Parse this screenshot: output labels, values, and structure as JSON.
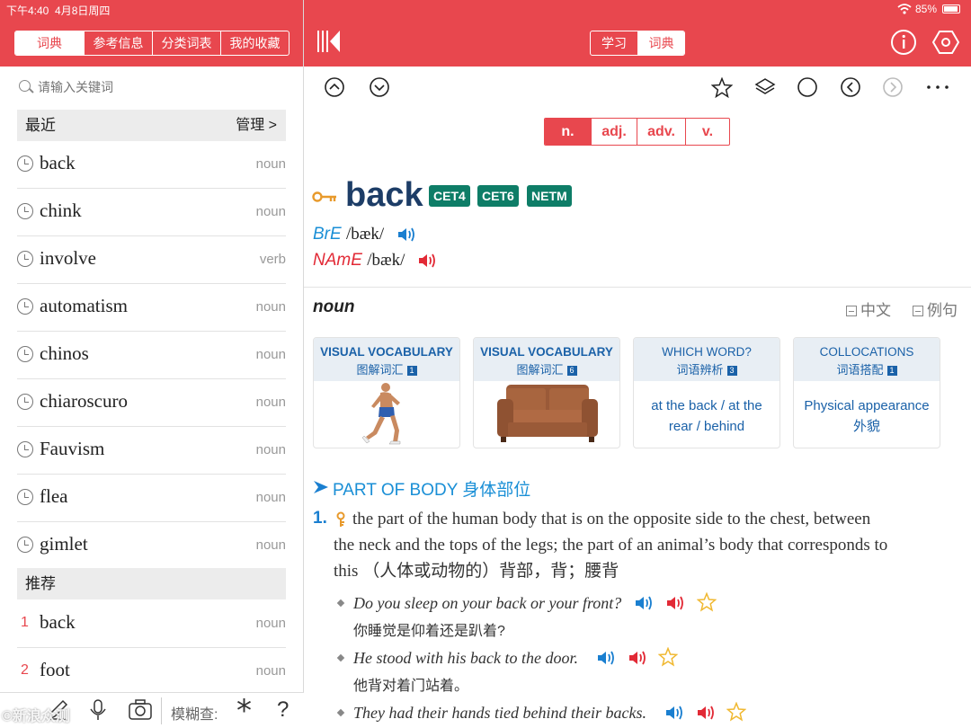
{
  "status": {
    "time": "下午4:40",
    "date": "4月8日周四",
    "battery": "85%"
  },
  "left_tabs": [
    "词典",
    "参考信息",
    "分类词表",
    "我的收藏"
  ],
  "search": {
    "placeholder": "请输入关键词"
  },
  "recent": {
    "title": "最近",
    "manage": "管理 >",
    "items": [
      {
        "word": "back",
        "pos": "noun"
      },
      {
        "word": "chink",
        "pos": "noun"
      },
      {
        "word": "involve",
        "pos": "verb"
      },
      {
        "word": "automatism",
        "pos": "noun"
      },
      {
        "word": "chinos",
        "pos": "noun"
      },
      {
        "word": "chiaroscuro",
        "pos": "noun"
      },
      {
        "word": "Fauvism",
        "pos": "noun"
      },
      {
        "word": "flea",
        "pos": "noun"
      },
      {
        "word": "gimlet",
        "pos": "noun"
      }
    ]
  },
  "recommend": {
    "title": "推荐",
    "items": [
      {
        "num": "1",
        "word": "back",
        "pos": "noun"
      },
      {
        "num": "2",
        "word": "foot",
        "pos": "noun"
      }
    ]
  },
  "bottom": {
    "fuzzy": "模糊查:",
    "star": "*",
    "question": "?",
    "watermark": "©新浪众测"
  },
  "right_tabs": [
    "学习",
    "词典"
  ],
  "pos_tabs": [
    "n.",
    "adj.",
    "adv.",
    "v."
  ],
  "entry": {
    "headword": "back",
    "tags": [
      "CET4",
      "CET6",
      "NETM"
    ],
    "bre_label": "BrE",
    "bre_ipa": "/bæk/",
    "name_label": "NAmE",
    "name_ipa": "/bæk/",
    "pos": "noun",
    "chinese_toggle": "中文",
    "example_toggle": "例句",
    "cards": [
      {
        "title": "VISUAL VOCABULARY",
        "sub": "图解词汇",
        "n": "1"
      },
      {
        "title": "VISUAL VOCABULARY",
        "sub": "图解词汇",
        "n": "6"
      },
      {
        "title": "WHICH  WORD?",
        "sub": "词语辨析",
        "n": "3",
        "text1": "at the back / at the",
        "text2": "rear / behind"
      },
      {
        "title": "COLLOCATIONS",
        "sub": "词语搭配",
        "n": "1",
        "text1": "Physical appearance",
        "text2": "外貌"
      }
    ],
    "sense_title": "PART OF BODY 身体部位",
    "sense_num": "1.",
    "def_l1": "the part of the human body that is on the opposite side to the chest, between",
    "def_l2": "the neck and the tops of the legs; the part of an animal’s body that corresponds to",
    "def_l3": "this （人体或动物的）背部，背；腰背",
    "examples": [
      {
        "en": "Do you sleep on your back or your front?",
        "zh": "你睡觉是仰着还是趴着?"
      },
      {
        "en": "He stood with his back to the door.",
        "zh": "他背对着门站着。"
      },
      {
        "en": "They had their hands tied behind their backs.",
        "zh": ""
      }
    ]
  },
  "colors": {
    "accent": "#e8474e",
    "blue": "#1a61a8",
    "green": "#0e7d67"
  }
}
